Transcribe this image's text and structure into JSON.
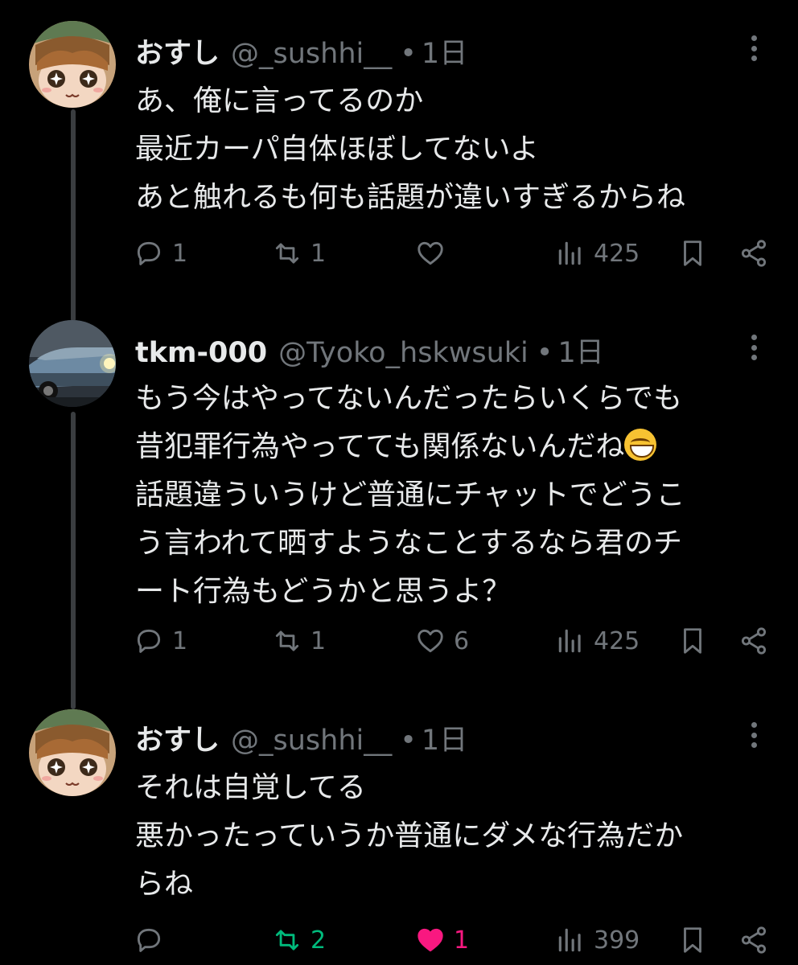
{
  "tweets": [
    {
      "name": "おすし",
      "handle": "@_sushhi__",
      "time": "1日",
      "lines": [
        "あ、俺に言ってるのか",
        "最近カーパ自体ほぼしてないよ",
        "あと触れるも何も話題が違いすぎるからね"
      ],
      "replies": "1",
      "retweets": "1",
      "likes": "",
      "views": "425",
      "avatar": "anime-girl-avatar"
    },
    {
      "name": "tkm-000",
      "handle": "@Tyoko_hskwsuki",
      "time": "1日",
      "lines": [
        "もう今はやってないんだったらいくらでも",
        "昔犯罪行為やってても関係ないんだね",
        "話題違ういうけど普通にチャットでどうこ",
        "う言われて晒すようなことするなら君のチ",
        "ート行為もどうかと思うよ？"
      ],
      "emoji": "grinning-face-emoji",
      "replies": "1",
      "retweets": "1",
      "likes": "6",
      "views": "425",
      "avatar": "car-avatar"
    },
    {
      "name": "おすし",
      "handle": "@_sushhi__",
      "time": "1日",
      "lines": [
        "それは自覚してる",
        "悪かったっていうか普通にダメな行為だか",
        "らね"
      ],
      "replies": "",
      "retweets": "2",
      "likes": "1",
      "views": "399",
      "avatar": "anime-girl-avatar",
      "retweeted": true,
      "liked": true
    }
  ],
  "colors": {
    "background": "#000000",
    "text": "#e7e9ea",
    "muted": "#71767b",
    "retweet_active": "#00ba7c",
    "like_active": "#f91880"
  },
  "icons": [
    "reply-icon",
    "retweet-icon",
    "heart-icon",
    "views-icon",
    "bookmark-icon",
    "share-icon",
    "more-icon"
  ]
}
